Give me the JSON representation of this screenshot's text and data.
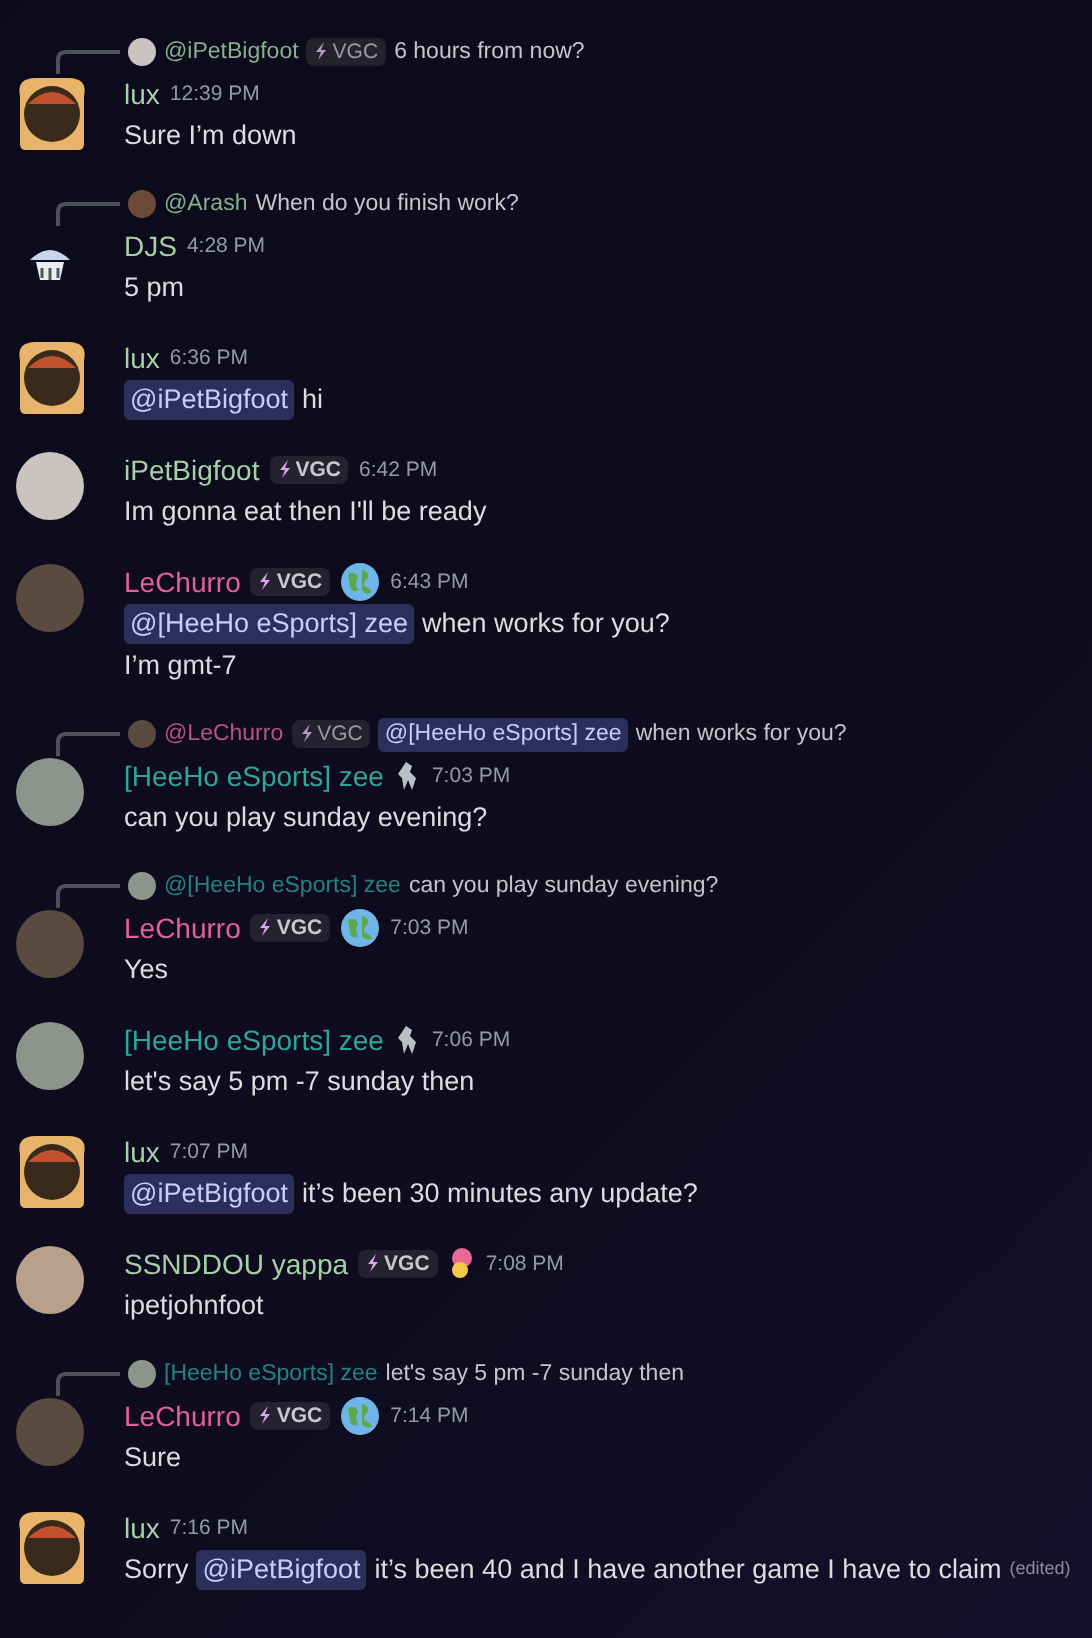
{
  "messages": [
    {
      "reply": {
        "avatar": {
          "kind": "cat"
        },
        "author": "@iPetBigfoot",
        "color": "#8fb897",
        "tag": "VGC",
        "content": [
          {
            "kind": "text",
            "text": "6 hours from now?"
          }
        ]
      },
      "avatar": {
        "kind": "toast"
      },
      "author": "lux",
      "color": "#a6d0a8",
      "time": "12:39 PM",
      "lines": [
        [
          {
            "kind": "text",
            "text": "Sure I’m down"
          }
        ]
      ]
    },
    {
      "reply": {
        "avatar": {
          "kind": "man"
        },
        "author": "@Arash",
        "color": "#8fb897",
        "content": [
          {
            "kind": "text",
            "text": "When do you finish work?"
          }
        ]
      },
      "avatar": {
        "kind": "mascot"
      },
      "author": "DJS",
      "color": "#a6d0a8",
      "time": "4:28 PM",
      "lines": [
        [
          {
            "kind": "text",
            "text": "5 pm"
          }
        ]
      ]
    },
    {
      "avatar": {
        "kind": "toast"
      },
      "author": "lux",
      "color": "#a6d0a8",
      "time": "6:36 PM",
      "lines": [
        [
          {
            "kind": "mention",
            "text": "@iPetBigfoot"
          },
          {
            "kind": "text",
            "text": "hi"
          }
        ]
      ]
    },
    {
      "avatar": {
        "kind": "cat"
      },
      "author": "iPetBigfoot",
      "color": "#a6d0a8",
      "tag": "VGC",
      "time": "6:42 PM",
      "lines": [
        [
          {
            "kind": "text",
            "text": "Im gonna eat then I'll be ready"
          }
        ]
      ]
    },
    {
      "avatar": {
        "kind": "dog"
      },
      "author": "LeChurro",
      "color": "#e3609a",
      "tag": "VGC",
      "badge": {
        "kind": "globe"
      },
      "time": "6:43 PM",
      "lines": [
        [
          {
            "kind": "mention",
            "text": "@[HeeHo eSports] zee"
          },
          {
            "kind": "text",
            "text": "when works for you?"
          }
        ],
        [
          {
            "kind": "text",
            "text": "I’m gmt-7"
          }
        ]
      ]
    },
    {
      "reply": {
        "avatar": {
          "kind": "dog"
        },
        "author": "@LeChurro",
        "color": "#c05688",
        "tag": "VGC",
        "content": [
          {
            "kind": "mention",
            "text": "@[HeeHo eSports] zee"
          },
          {
            "kind": "text",
            "text": "when works for you?"
          }
        ]
      },
      "avatar": {
        "kind": "anime"
      },
      "author": "[HeeHo eSports] zee",
      "color": "#2fa59c",
      "badge": {
        "kind": "figure"
      },
      "time": "7:03 PM",
      "lines": [
        [
          {
            "kind": "text",
            "text": "can you play sunday evening?"
          }
        ]
      ]
    },
    {
      "reply": {
        "avatar": {
          "kind": "anime"
        },
        "author": "@[HeeHo eSports] zee",
        "color": "#268a83",
        "content": [
          {
            "kind": "text",
            "text": "can you play sunday evening?"
          }
        ]
      },
      "avatar": {
        "kind": "dog"
      },
      "author": "LeChurro",
      "color": "#e3609a",
      "tag": "VGC",
      "badge": {
        "kind": "globe"
      },
      "time": "7:03 PM",
      "lines": [
        [
          {
            "kind": "text",
            "text": "Yes"
          }
        ]
      ]
    },
    {
      "avatar": {
        "kind": "anime"
      },
      "author": "[HeeHo eSports] zee",
      "color": "#2fa59c",
      "badge": {
        "kind": "figure"
      },
      "time": "7:06 PM",
      "lines": [
        [
          {
            "kind": "text",
            "text": "let's say 5 pm -7 sunday then"
          }
        ]
      ]
    },
    {
      "avatar": {
        "kind": "toast"
      },
      "author": "lux",
      "color": "#a6d0a8",
      "time": "7:07 PM",
      "lines": [
        [
          {
            "kind": "mention",
            "text": "@iPetBigfoot"
          },
          {
            "kind": "text",
            "text": "it’s been 30 minutes any update?"
          }
        ]
      ]
    },
    {
      "avatar": {
        "kind": "girl"
      },
      "author": "SSNDDOU yappa",
      "color": "#a6d0a8",
      "tag": "VGC",
      "badge": {
        "kind": "flower"
      },
      "time": "7:08 PM",
      "lines": [
        [
          {
            "kind": "text",
            "text": "ipetjohnfoot"
          }
        ]
      ]
    },
    {
      "reply": {
        "avatar": {
          "kind": "anime"
        },
        "author": "[HeeHo eSports] zee",
        "color": "#268a83",
        "content": [
          {
            "kind": "text",
            "text": "let's say 5 pm -7 sunday then"
          }
        ]
      },
      "avatar": {
        "kind": "dog"
      },
      "author": "LeChurro",
      "color": "#e3609a",
      "tag": "VGC",
      "badge": {
        "kind": "globe"
      },
      "time": "7:14 PM",
      "lines": [
        [
          {
            "kind": "text",
            "text": "Sure"
          }
        ]
      ]
    },
    {
      "avatar": {
        "kind": "toast"
      },
      "author": "lux",
      "color": "#a6d0a8",
      "time": "7:16 PM",
      "lines": [
        [
          {
            "kind": "text",
            "text": "Sorry"
          },
          {
            "kind": "mention",
            "text": "@iPetBigfoot"
          },
          {
            "kind": "text",
            "text": "it’s been 40 and I have another game I have to claim"
          }
        ]
      ],
      "edited": "(edited)"
    }
  ]
}
